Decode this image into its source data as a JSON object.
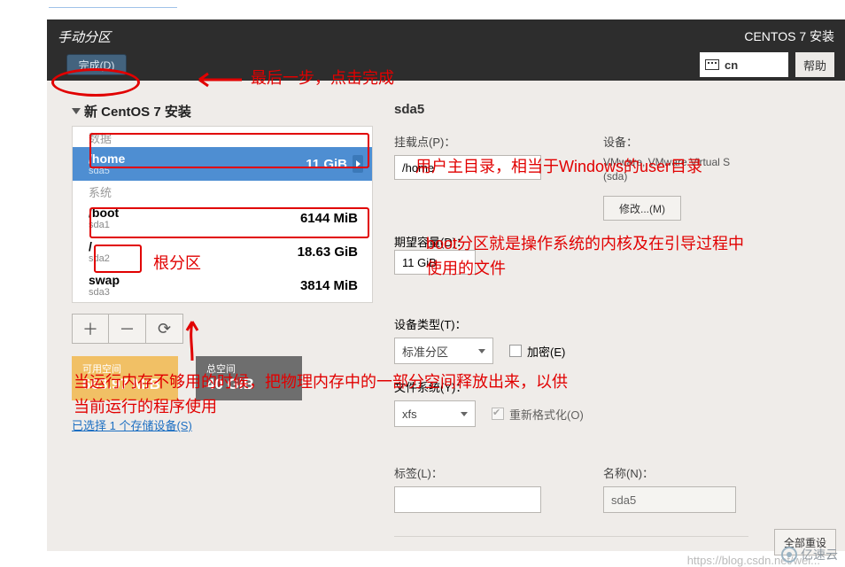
{
  "header": {
    "title_left": "手动分区",
    "title_right": "CENTOS 7 安装",
    "done_button": "完成(D)",
    "lang_code": "cn",
    "help_button": "帮助"
  },
  "annotations": {
    "done": "最后一步，点击完成",
    "root": "根分区",
    "home": "用户主目录，相当于Windows的user目录",
    "boot": "boot分区就是操作系统的内核及在引导过程中使用的文件",
    "swap": "当运行内存不够用的时候，把物理内存中的一部分空间释放出来，以供当前运行的程序使用"
  },
  "left": {
    "install_label": "新 CentOS 7 安装",
    "section_data": "数据",
    "section_system": "系统",
    "items": [
      {
        "path": "/home",
        "dev": "sda5",
        "size": "11 GiB",
        "selected": true
      },
      {
        "path": "/boot",
        "dev": "sda1",
        "size": "6144 MiB",
        "selected": false
      },
      {
        "path": "/",
        "dev": "sda2",
        "size": "18.63 GiB",
        "selected": false
      },
      {
        "path": "swap",
        "dev": "sda3",
        "size": "3814 MiB",
        "selected": false
      }
    ],
    "avail_label": "可用空间",
    "avail_value": "663.97 MiB",
    "total_label": "总空间",
    "total_value": "40 GiB",
    "selected_link": "已选择 1 个存储设备(S)"
  },
  "right": {
    "title": "sda5",
    "mount_label": "挂载点(P)：",
    "mount_value": "/home",
    "capacity_label": "期望容量(D)：",
    "capacity_value": "11 GiB",
    "device_section_label": "设备：",
    "device_text": "VMware, VMware Virtual S (sda)",
    "modify_button": "修改...(M)",
    "type_label": "设备类型(T)：",
    "type_value": "标准分区",
    "encrypt_label": "加密(E)",
    "fs_label": "文件系统(Y)：",
    "fs_value": "xfs",
    "reformat_label": "重新格式化(O)",
    "tag_label": "标签(L)：",
    "name_label": "名称(N)：",
    "name_value": "sda5",
    "reset_all": "全部重设"
  },
  "watermarks": {
    "url": "https://blog.csdn.net/wei...",
    "logo_text": "亿速云"
  }
}
